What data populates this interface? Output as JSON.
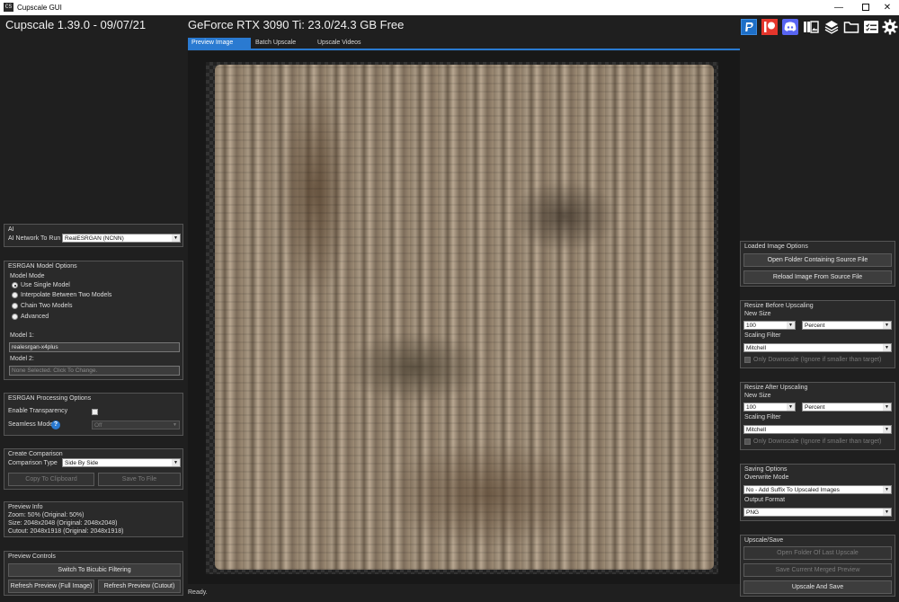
{
  "window": {
    "title": "Cupscale GUI",
    "icon_text": "CS",
    "min": "—",
    "max": "",
    "close": "✕"
  },
  "header": {
    "app": "Cupscale 1.39.0 - 09/07/21",
    "gpu": "GeForce RTX 3090 Ti: 23.0/24.3 GB Free"
  },
  "tabs": [
    {
      "label": "Preview Image",
      "active": true
    },
    {
      "label": "Batch Upscale",
      "active": false
    },
    {
      "label": "Upscale Videos",
      "active": false
    }
  ],
  "topbar_icons": [
    "paypal-icon",
    "patreon-icon",
    "discord-icon",
    "models-icon",
    "layers-icon",
    "folder-icon",
    "queue-icon",
    "gear-icon"
  ],
  "status": "Ready.",
  "ai": {
    "title": "AI",
    "network_label": "AI Network To Run",
    "network_value": "RealESRGAN (NCNN)"
  },
  "esrgan": {
    "title": "ESRGAN Model Options",
    "mode_label": "Model Mode",
    "modes": [
      "Use Single Model",
      "Interpolate Between Two Models",
      "Chain Two Models",
      "Advanced"
    ],
    "selected_mode": 0,
    "model1_label": "Model 1:",
    "model1_value": "realesrgan-x4plus",
    "model2_label": "Model 2:",
    "model2_value": "None Selected. Click To Change."
  },
  "processing": {
    "title": "ESRGAN Processing Options",
    "transparency_label": "Enable Transparency",
    "seamless_label": "Seamless Mode",
    "seamless_help": "?",
    "seamless_value": "Off"
  },
  "comparison": {
    "title": "Create Comparison",
    "type_label": "Comparison Type",
    "type_value": "Side By Side",
    "copy_button": "Copy To Clipboard",
    "save_button": "Save To File"
  },
  "preview_info": {
    "title": "Preview Info",
    "zoom": "Zoom: 50% (Original: 50%)",
    "size": "Size: 2048x2048 (Original: 2048x2048)",
    "cutout": "Cutout: 2048x1918 (Original: 2048x1918)"
  },
  "preview_controls": {
    "title": "Preview Controls",
    "bicubic_button": "Switch To Bicubic Filtering",
    "refresh_full": "Refresh Preview (Full Image)",
    "refresh_cutout": "Refresh Preview (Cutout)"
  },
  "loaded": {
    "title": "Loaded Image Options",
    "open_folder": "Open Folder Containing Source File",
    "reload": "Reload Image From Source File"
  },
  "resize_before": {
    "title": "Resize Before Upscaling",
    "new_size_label": "New Size",
    "size_value": "100",
    "unit_value": "Percent",
    "filter_label": "Scaling Filter",
    "filter_value": "Mitchell",
    "downscale_label": "Only Downscale (Ignore if smaller than target)"
  },
  "resize_after": {
    "title": "Resize After Upscaling",
    "new_size_label": "New Size",
    "size_value": "100",
    "unit_value": "Percent",
    "filter_label": "Scaling Filter",
    "filter_value": "Mitchell",
    "downscale_label": "Only Downscale (Ignore if smaller than target)"
  },
  "saving": {
    "title": "Saving Options",
    "overwrite_label": "Overwrite Mode",
    "overwrite_value": "No - Add Suffix To Upscaled Images",
    "format_label": "Output Format",
    "format_value": "PNG"
  },
  "upscale_save": {
    "title": "Upscale/Save",
    "open_last": "Open Folder Of Last Upscale",
    "save_merged": "Save Current Merged Preview",
    "upscale": "Upscale And Save"
  },
  "colors": {
    "accent": "#2a7ad1",
    "background": "#1f1f1f",
    "panel": "#2a2a2a"
  }
}
